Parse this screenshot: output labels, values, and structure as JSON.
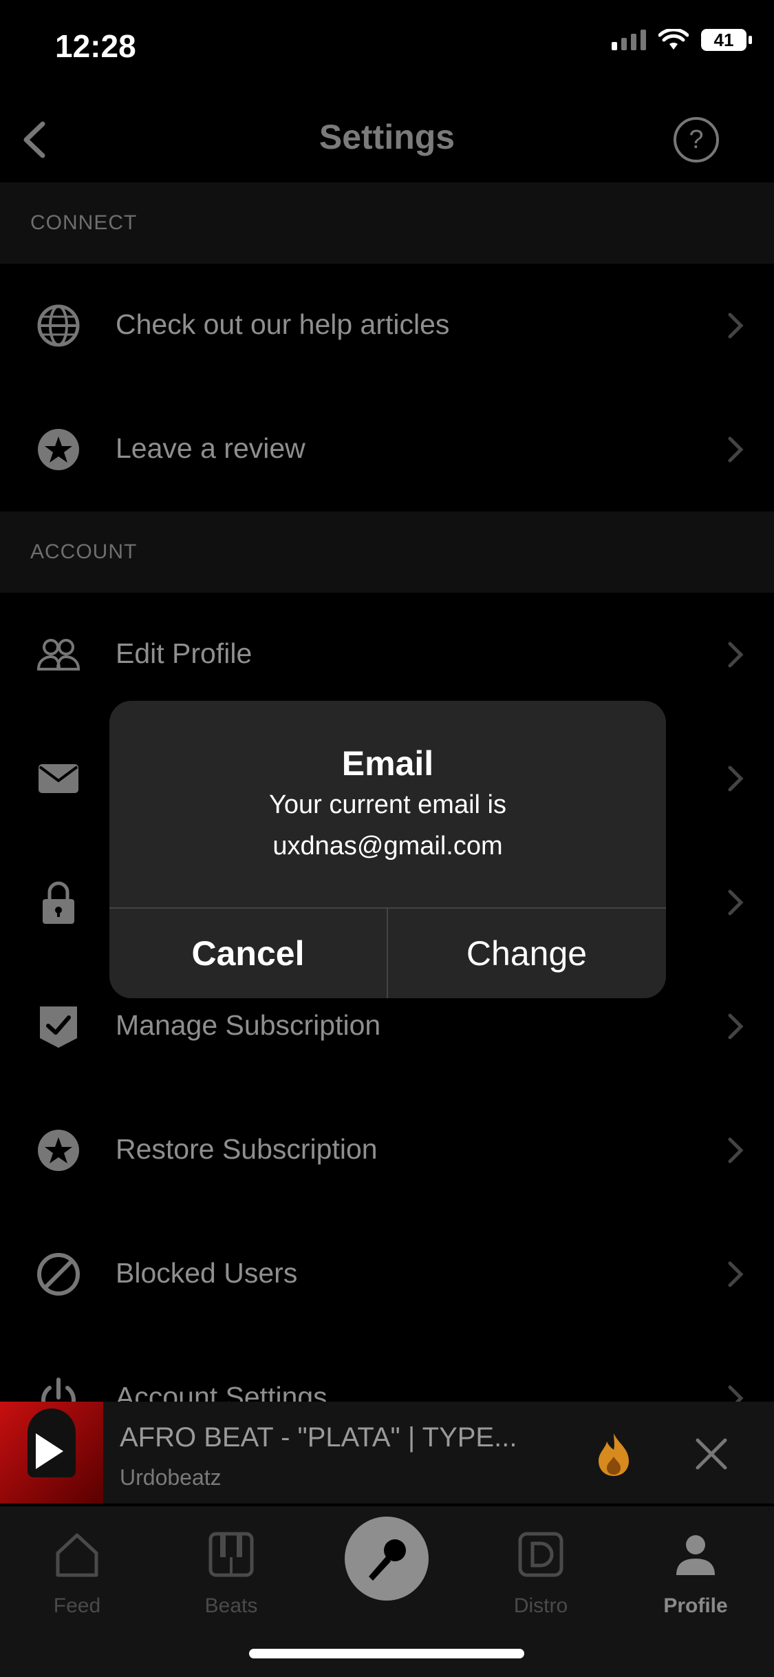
{
  "status": {
    "time": "12:28",
    "battery": "41"
  },
  "header": {
    "title": "Settings",
    "help_glyph": "?"
  },
  "sections": {
    "connect": "CONNECT",
    "account": "ACCOUNT"
  },
  "rows": {
    "help": "Check out our help articles",
    "review": "Leave a review",
    "edit_profile": "Edit Profile",
    "manage_subscription": "Manage Subscription",
    "restore_subscription": "Restore Subscription",
    "blocked_users": "Blocked Users",
    "account_settings": "Account Settings"
  },
  "dialog": {
    "title": "Email",
    "message_line1": "Your current email is",
    "message_line2": "uxdnas@gmail.com",
    "cancel": "Cancel",
    "change": "Change"
  },
  "player": {
    "title": "AFRO BEAT - \"PLATA\" | TYPE...",
    "artist": "Urdobeatz"
  },
  "tabs": {
    "feed": "Feed",
    "beats": "Beats",
    "distro": "Distro",
    "profile": "Profile"
  },
  "icons": {
    "back": "chevron-left-icon",
    "help": "question-circle-icon",
    "globe": "globe-icon",
    "star": "star-icon",
    "people": "people-icon",
    "mail": "mail-icon",
    "lock": "lock-icon",
    "shield_check": "shield-check-icon",
    "block": "block-icon",
    "power": "power-icon",
    "flame": "flame-icon",
    "mic": "microphone-icon"
  }
}
